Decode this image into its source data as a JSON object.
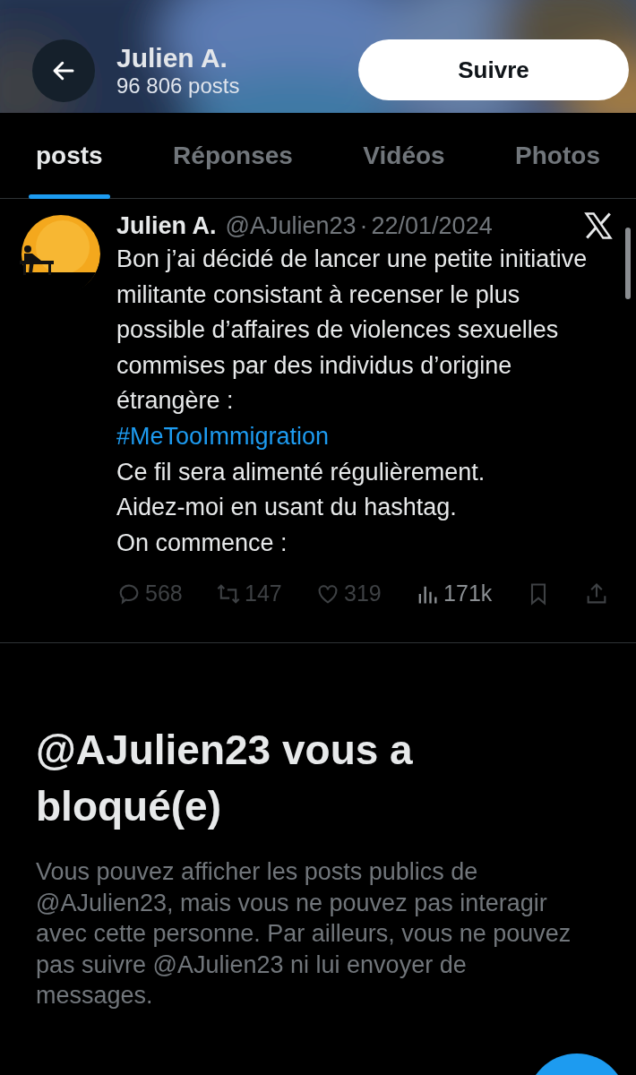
{
  "header": {
    "name": "Julien A.",
    "post_count": "96 806 posts",
    "follow_button": "Suivre"
  },
  "tabs": [
    {
      "label": "posts",
      "selected": true
    },
    {
      "label": "Réponses",
      "selected": false
    },
    {
      "label": "Vidéos",
      "selected": false
    },
    {
      "label": "Photos",
      "selected": false
    }
  ],
  "post": {
    "author": "Julien A.",
    "handle": "@AJulien23",
    "separator": "·",
    "date": "22/01/2024",
    "body": [
      {
        "kind": "text",
        "text": "Bon j’ai décidé de lancer une petite initiative militante consistant à recenser le plus possible d’affaires de violences sexuelles commises par des individus d’origine étrangère :"
      },
      {
        "kind": "hashtag",
        "text": "#MeTooImmigration"
      },
      {
        "kind": "text",
        "text": "Ce fil sera alimenté régulièrement."
      },
      {
        "kind": "text",
        "text": "Aidez-moi en usant du hashtag."
      },
      {
        "kind": "text",
        "text": "On commence :"
      }
    ],
    "actions": [
      {
        "kind": "reply",
        "count": "568"
      },
      {
        "kind": "repost",
        "count": "147"
      },
      {
        "kind": "like",
        "count": "319"
      },
      {
        "kind": "views",
        "count": "171k"
      },
      {
        "kind": "bookmark"
      },
      {
        "kind": "share"
      }
    ]
  },
  "blocked": {
    "title": "@AJulien23 vous a bloqué(e)",
    "message": "Vous pouvez afficher les posts publics de @AJulien23, mais vous ne pouvez pas interagir avec cette personne. Par ailleurs, vous ne pouvez pas suivre @AJulien23 ni lui envoyer de messages."
  }
}
